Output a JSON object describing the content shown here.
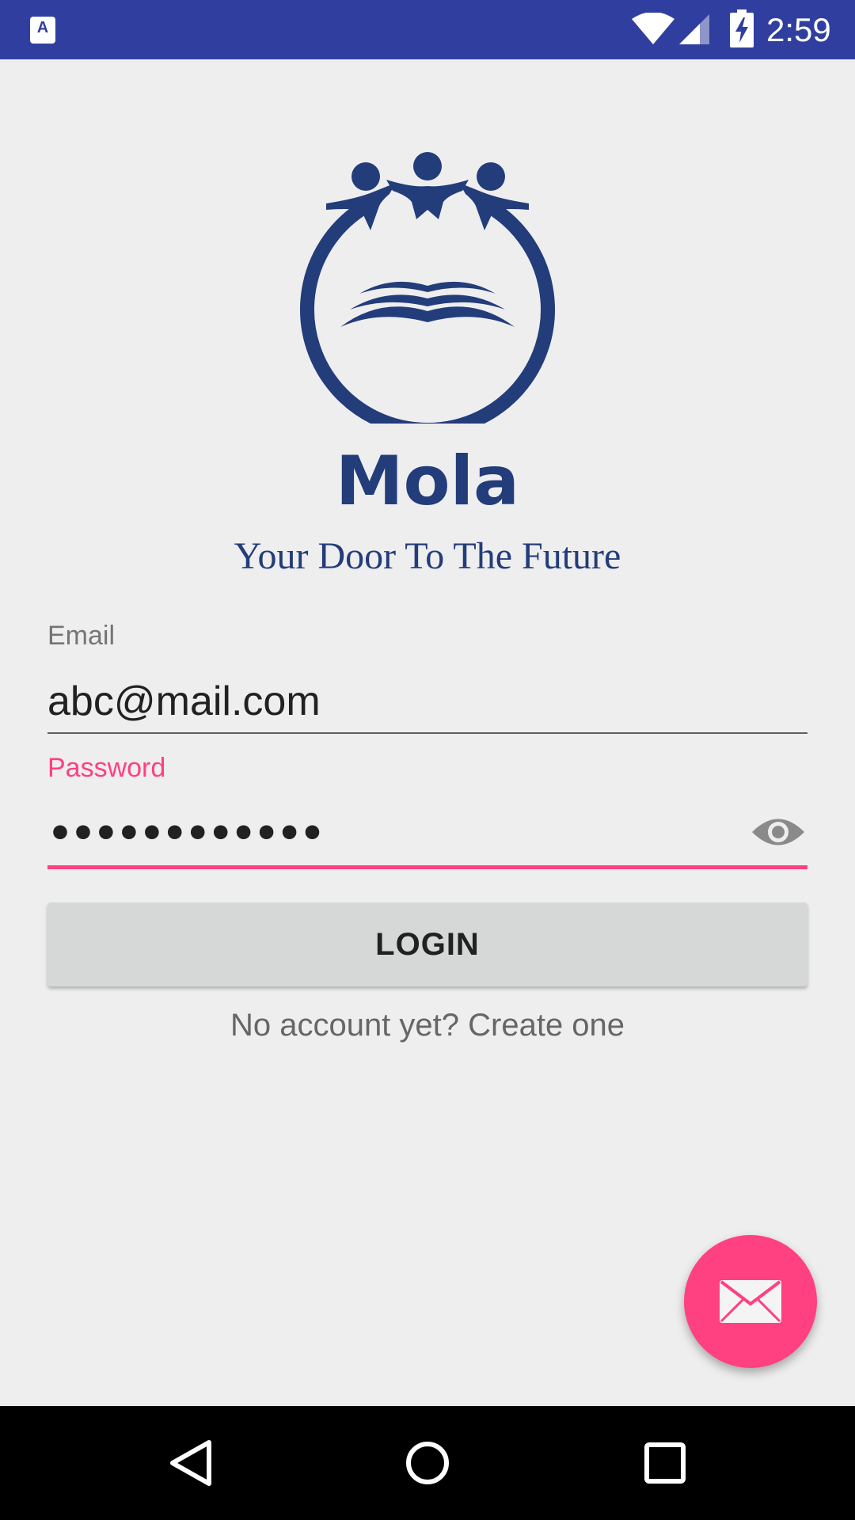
{
  "status_bar": {
    "app_icon_letter": "A",
    "time": "2:59",
    "background": "#303f9f"
  },
  "brand": {
    "name": "Mola",
    "tagline": "Your Door To The Future",
    "color": "#233c7a"
  },
  "form": {
    "email_label": "Email",
    "email_value": "abc@mail.com",
    "password_label": "Password",
    "password_masked": "••••••••••••",
    "login_label": "LOGIN",
    "signup_text": "No account yet? Create one"
  },
  "colors": {
    "accent": "#ff4081",
    "button_bg": "#d6d7d7"
  },
  "icons": {
    "wifi": "wifi-icon",
    "signal": "cell-signal-icon",
    "battery": "battery-charging-icon",
    "eye": "eye-icon",
    "fab": "mail-icon",
    "back": "back-icon",
    "home": "home-icon",
    "recents": "recents-icon"
  }
}
